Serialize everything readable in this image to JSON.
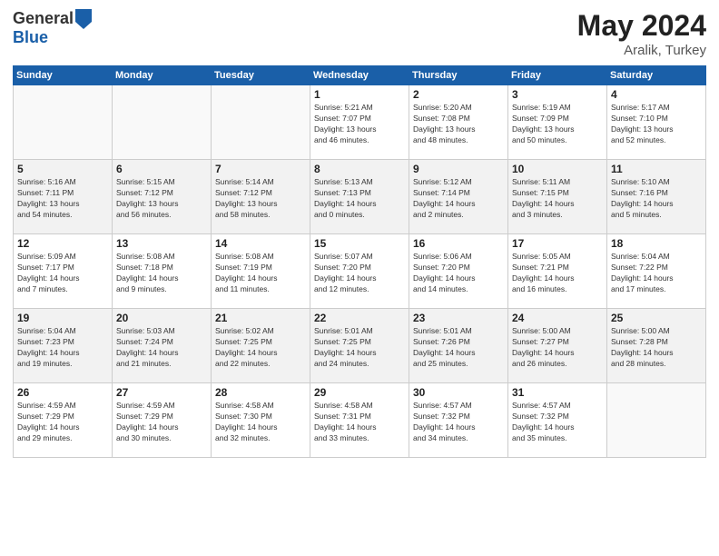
{
  "header": {
    "logo_general": "General",
    "logo_blue": "Blue",
    "title": "May 2024",
    "location": "Aralik, Turkey"
  },
  "days_of_week": [
    "Sunday",
    "Monday",
    "Tuesday",
    "Wednesday",
    "Thursday",
    "Friday",
    "Saturday"
  ],
  "weeks": [
    {
      "days": [
        {
          "num": "",
          "info": ""
        },
        {
          "num": "",
          "info": ""
        },
        {
          "num": "",
          "info": ""
        },
        {
          "num": "1",
          "info": "Sunrise: 5:21 AM\nSunset: 7:07 PM\nDaylight: 13 hours\nand 46 minutes."
        },
        {
          "num": "2",
          "info": "Sunrise: 5:20 AM\nSunset: 7:08 PM\nDaylight: 13 hours\nand 48 minutes."
        },
        {
          "num": "3",
          "info": "Sunrise: 5:19 AM\nSunset: 7:09 PM\nDaylight: 13 hours\nand 50 minutes."
        },
        {
          "num": "4",
          "info": "Sunrise: 5:17 AM\nSunset: 7:10 PM\nDaylight: 13 hours\nand 52 minutes."
        }
      ]
    },
    {
      "days": [
        {
          "num": "5",
          "info": "Sunrise: 5:16 AM\nSunset: 7:11 PM\nDaylight: 13 hours\nand 54 minutes."
        },
        {
          "num": "6",
          "info": "Sunrise: 5:15 AM\nSunset: 7:12 PM\nDaylight: 13 hours\nand 56 minutes."
        },
        {
          "num": "7",
          "info": "Sunrise: 5:14 AM\nSunset: 7:12 PM\nDaylight: 13 hours\nand 58 minutes."
        },
        {
          "num": "8",
          "info": "Sunrise: 5:13 AM\nSunset: 7:13 PM\nDaylight: 14 hours\nand 0 minutes."
        },
        {
          "num": "9",
          "info": "Sunrise: 5:12 AM\nSunset: 7:14 PM\nDaylight: 14 hours\nand 2 minutes."
        },
        {
          "num": "10",
          "info": "Sunrise: 5:11 AM\nSunset: 7:15 PM\nDaylight: 14 hours\nand 3 minutes."
        },
        {
          "num": "11",
          "info": "Sunrise: 5:10 AM\nSunset: 7:16 PM\nDaylight: 14 hours\nand 5 minutes."
        }
      ]
    },
    {
      "days": [
        {
          "num": "12",
          "info": "Sunrise: 5:09 AM\nSunset: 7:17 PM\nDaylight: 14 hours\nand 7 minutes."
        },
        {
          "num": "13",
          "info": "Sunrise: 5:08 AM\nSunset: 7:18 PM\nDaylight: 14 hours\nand 9 minutes."
        },
        {
          "num": "14",
          "info": "Sunrise: 5:08 AM\nSunset: 7:19 PM\nDaylight: 14 hours\nand 11 minutes."
        },
        {
          "num": "15",
          "info": "Sunrise: 5:07 AM\nSunset: 7:20 PM\nDaylight: 14 hours\nand 12 minutes."
        },
        {
          "num": "16",
          "info": "Sunrise: 5:06 AM\nSunset: 7:20 PM\nDaylight: 14 hours\nand 14 minutes."
        },
        {
          "num": "17",
          "info": "Sunrise: 5:05 AM\nSunset: 7:21 PM\nDaylight: 14 hours\nand 16 minutes."
        },
        {
          "num": "18",
          "info": "Sunrise: 5:04 AM\nSunset: 7:22 PM\nDaylight: 14 hours\nand 17 minutes."
        }
      ]
    },
    {
      "days": [
        {
          "num": "19",
          "info": "Sunrise: 5:04 AM\nSunset: 7:23 PM\nDaylight: 14 hours\nand 19 minutes."
        },
        {
          "num": "20",
          "info": "Sunrise: 5:03 AM\nSunset: 7:24 PM\nDaylight: 14 hours\nand 21 minutes."
        },
        {
          "num": "21",
          "info": "Sunrise: 5:02 AM\nSunset: 7:25 PM\nDaylight: 14 hours\nand 22 minutes."
        },
        {
          "num": "22",
          "info": "Sunrise: 5:01 AM\nSunset: 7:25 PM\nDaylight: 14 hours\nand 24 minutes."
        },
        {
          "num": "23",
          "info": "Sunrise: 5:01 AM\nSunset: 7:26 PM\nDaylight: 14 hours\nand 25 minutes."
        },
        {
          "num": "24",
          "info": "Sunrise: 5:00 AM\nSunset: 7:27 PM\nDaylight: 14 hours\nand 26 minutes."
        },
        {
          "num": "25",
          "info": "Sunrise: 5:00 AM\nSunset: 7:28 PM\nDaylight: 14 hours\nand 28 minutes."
        }
      ]
    },
    {
      "days": [
        {
          "num": "26",
          "info": "Sunrise: 4:59 AM\nSunset: 7:29 PM\nDaylight: 14 hours\nand 29 minutes."
        },
        {
          "num": "27",
          "info": "Sunrise: 4:59 AM\nSunset: 7:29 PM\nDaylight: 14 hours\nand 30 minutes."
        },
        {
          "num": "28",
          "info": "Sunrise: 4:58 AM\nSunset: 7:30 PM\nDaylight: 14 hours\nand 32 minutes."
        },
        {
          "num": "29",
          "info": "Sunrise: 4:58 AM\nSunset: 7:31 PM\nDaylight: 14 hours\nand 33 minutes."
        },
        {
          "num": "30",
          "info": "Sunrise: 4:57 AM\nSunset: 7:32 PM\nDaylight: 14 hours\nand 34 minutes."
        },
        {
          "num": "31",
          "info": "Sunrise: 4:57 AM\nSunset: 7:32 PM\nDaylight: 14 hours\nand 35 minutes."
        },
        {
          "num": "",
          "info": ""
        }
      ]
    }
  ]
}
